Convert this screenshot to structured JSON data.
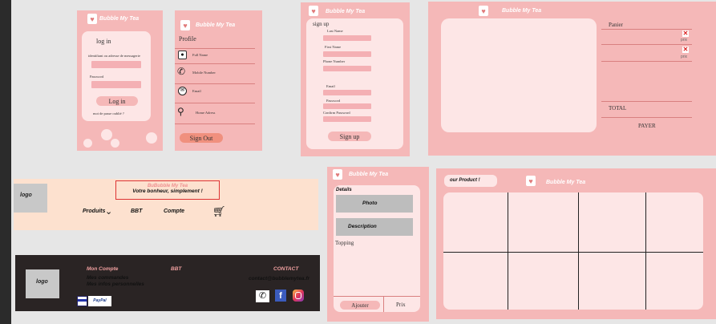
{
  "brand": "Bubble My Tea",
  "login": {
    "title": "log in",
    "id_label": "identifiant ou adresse de messagerie",
    "password_label": "Password",
    "button": "Log in",
    "forgot": "mot de passe oublié ?"
  },
  "profile": {
    "title": "Profile",
    "items": [
      "Full Name",
      "Mobile Number",
      "Email",
      "Home Adress"
    ],
    "signout": "Sign Out"
  },
  "signup": {
    "title": "sign up",
    "fields": [
      "Last Name",
      "First Name",
      "Phone Number",
      "Email",
      "Password",
      "Confirm Password"
    ],
    "button": "Sign up"
  },
  "cart": {
    "title": "Panier",
    "prix1": "prix",
    "prix2": "prix",
    "total": "TOTAL",
    "pay": "PAYER"
  },
  "header": {
    "logo": "logo",
    "brand_line": "BuBubble My Tea",
    "slogan": "Votre bonheur, simplement !",
    "nav": [
      "Produits",
      "BBT",
      "Compte"
    ]
  },
  "product": {
    "details": "Details",
    "photo": "Photo",
    "description": "Description",
    "topping": "Topping",
    "add": "Ajouter",
    "price": "Prix"
  },
  "catalog": {
    "badge": "our Product !"
  },
  "footer": {
    "logo": "logo",
    "account_title": "Mon Compte",
    "orders": "Mes commandes",
    "info": "Mes infos personnelles",
    "bbt": "BBT",
    "contact_title": "CONTACT",
    "email": "contact@bubblemytea.fr",
    "paypal": "PayPal"
  }
}
